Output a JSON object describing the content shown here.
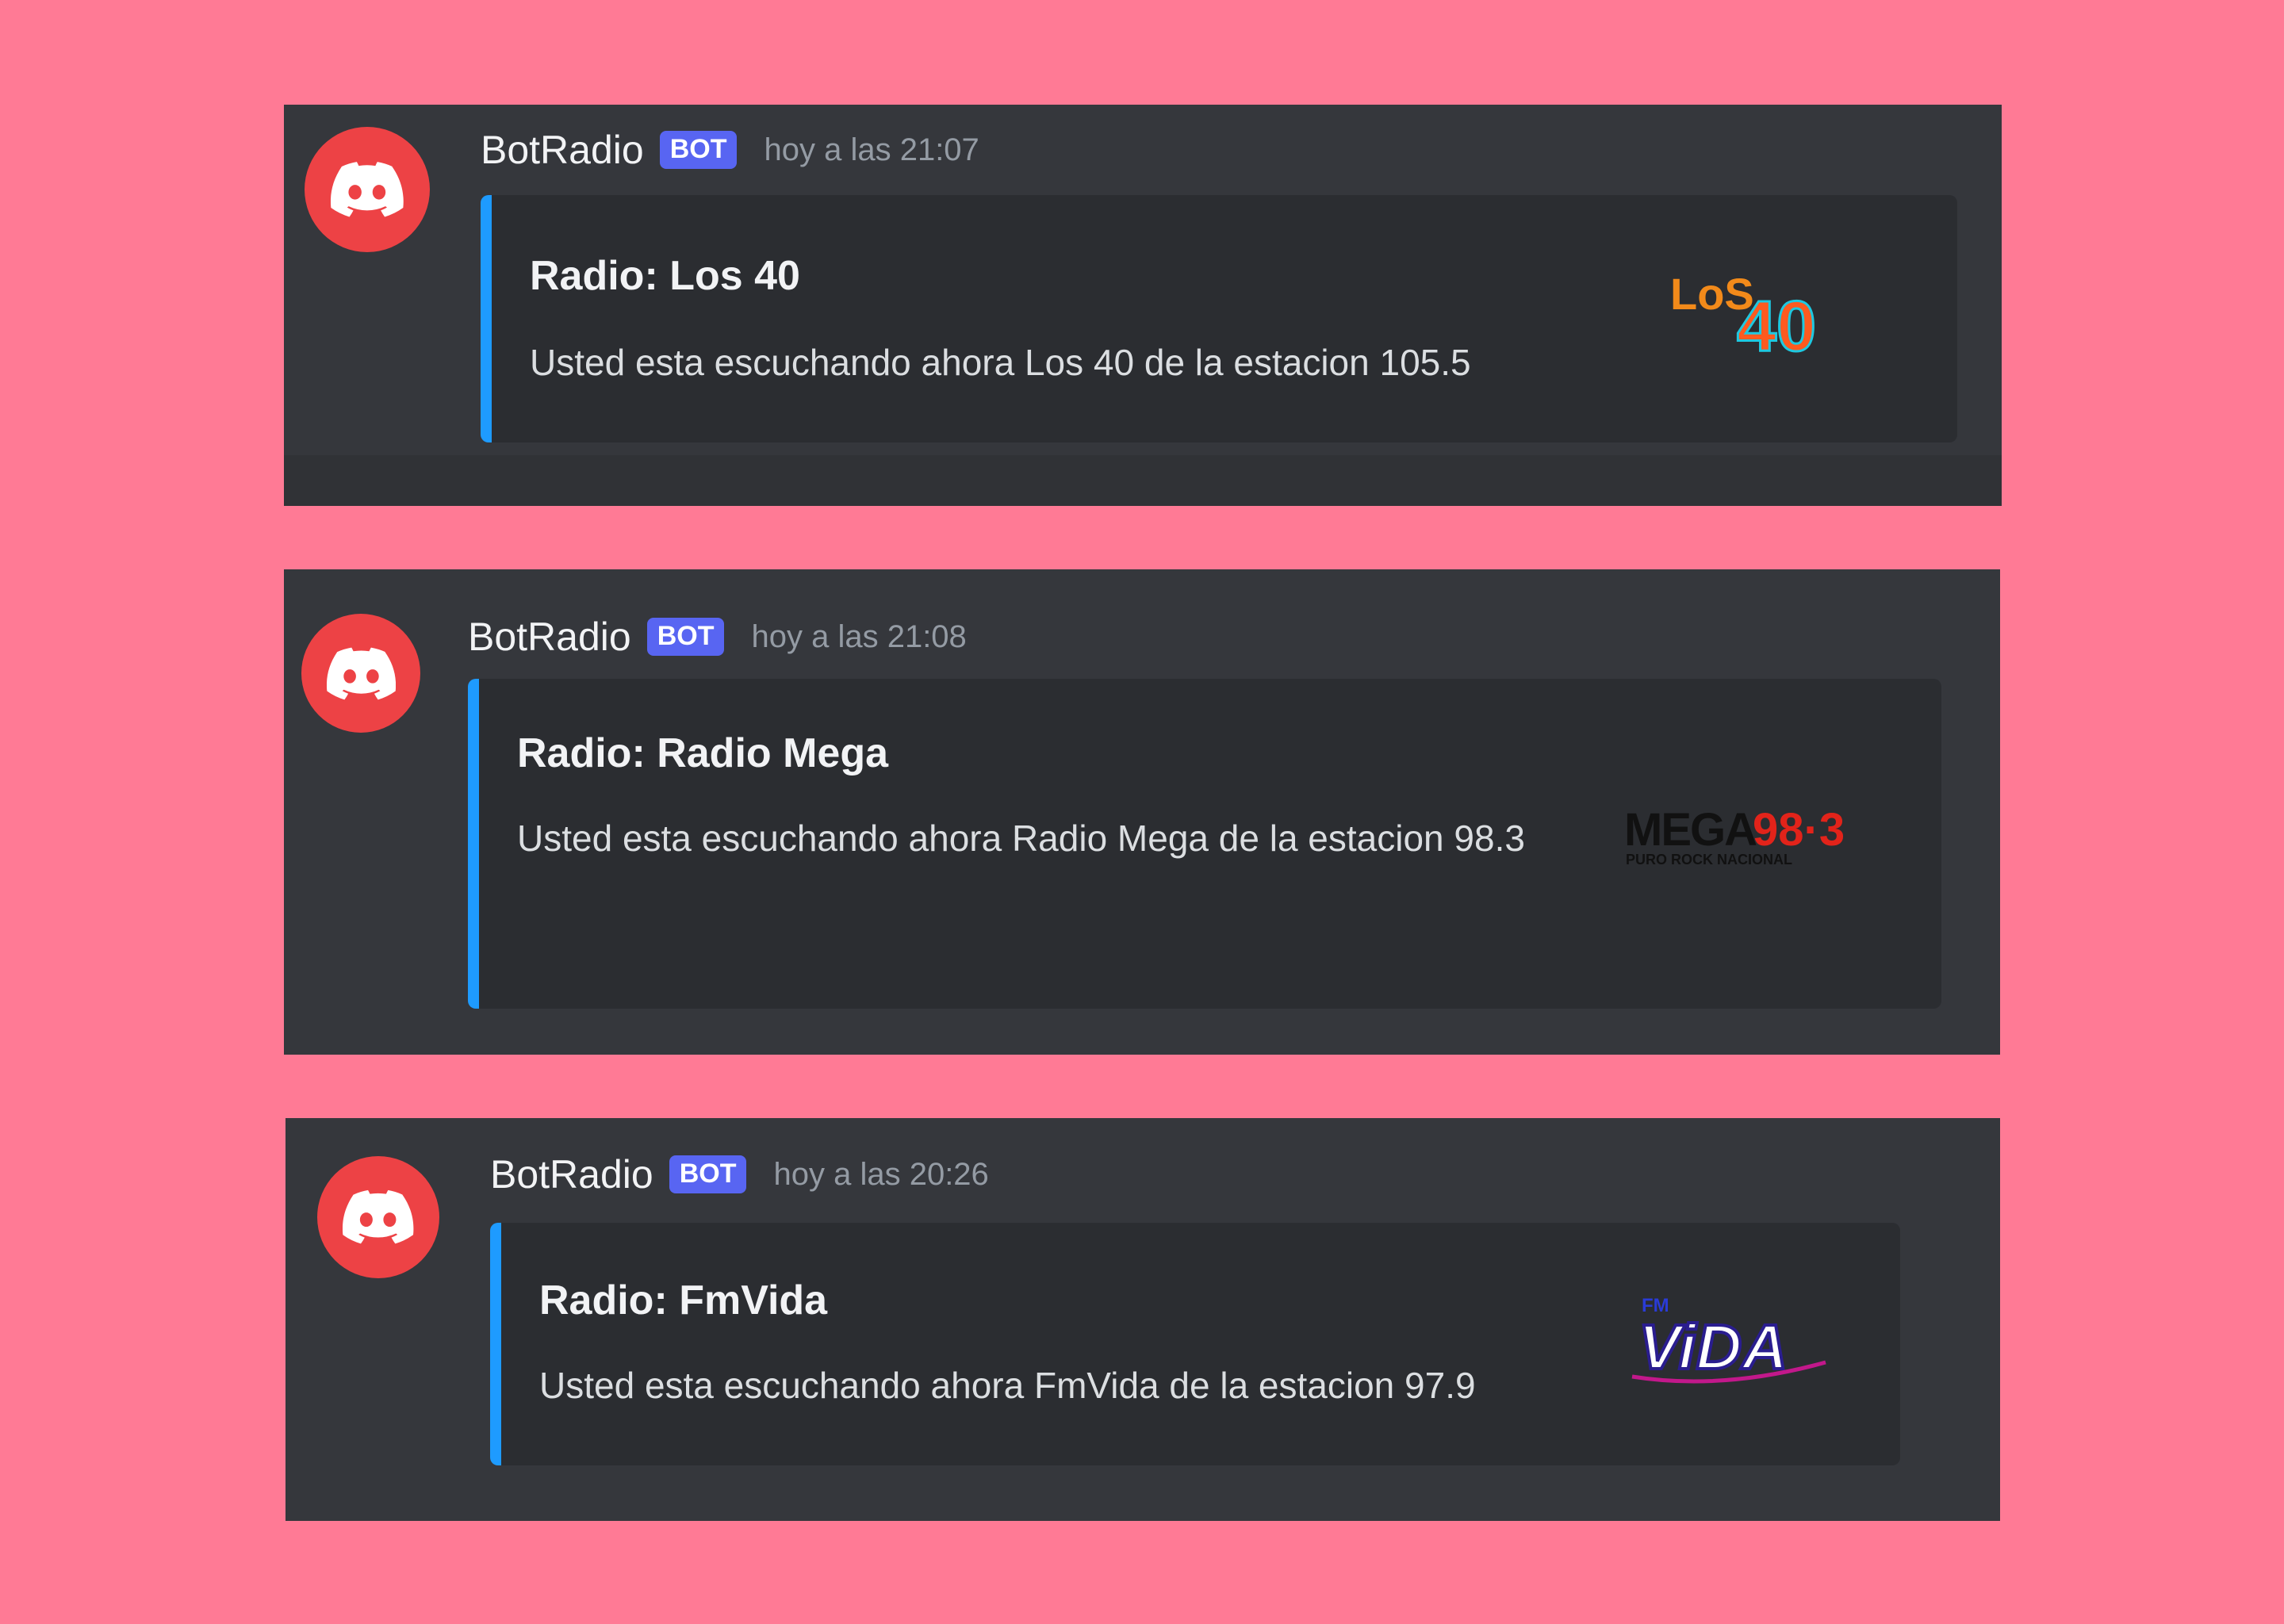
{
  "messages": [
    {
      "author": "BotRadio",
      "badge": "BOT",
      "timestamp": "hoy a las 21:07",
      "embed": {
        "title": "Radio: Los 40",
        "description": "Usted esta escuchando ahora Los 40 de la estacion 105.5",
        "accent_color": "#1e9bff"
      },
      "logo": {
        "icon": "los40-logo",
        "text_main": "LoS",
        "text_num": "40"
      }
    },
    {
      "author": "BotRadio",
      "badge": "BOT",
      "timestamp": "hoy a las 21:08",
      "embed": {
        "title": "Radio: Radio Mega",
        "description": "Usted esta escuchando ahora Radio Mega de la estacion 98.3",
        "accent_color": "#1e9bff"
      },
      "logo": {
        "icon": "mega-logo",
        "text_main": "MEGA",
        "text_num": "98·3",
        "tagline": "PURO ROCK NACIONAL"
      }
    },
    {
      "author": "BotRadio",
      "badge": "BOT",
      "timestamp": "hoy a las 20:26",
      "embed": {
        "title": "Radio: FmVida",
        "description": "Usted esta escuchando ahora FmVida de la estacion 97.9",
        "accent_color": "#1e9bff"
      },
      "logo": {
        "icon": "fmvida-logo",
        "text_small": "FM",
        "text_main": "ViDA"
      }
    }
  ],
  "colors": {
    "background": "#ff7a95",
    "panel": "#35373c",
    "embed": "#2b2d31",
    "avatar": "#ed4245",
    "badge": "#5865f2"
  }
}
